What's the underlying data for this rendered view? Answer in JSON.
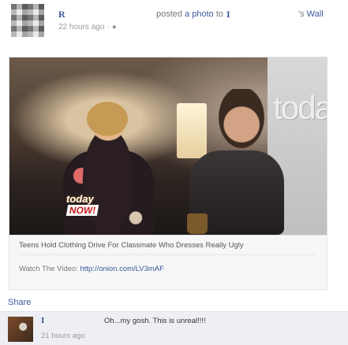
{
  "post": {
    "poster_name": "R",
    "posted_prefix": "posted",
    "posted_link": "a photo",
    "posted_to": "to",
    "wall_owner": "I",
    "wall_suffix": "'s",
    "wall_link": "Wall",
    "timestamp": "22 hours ago",
    "timestamp_sep": "·"
  },
  "photo": {
    "backdrop_text": "toda",
    "logo_today": "today",
    "logo_now": "NOW!"
  },
  "caption": {
    "title": "Teens Hold Clothing Drive For Classmate Who Dresses Really Ugly",
    "video_label": "Watch The Video:",
    "video_url": "http://onion.com/LV3mAF"
  },
  "actions": {
    "share_label": "Share"
  },
  "comment": {
    "author": "I",
    "time": "21 hours ago",
    "text": "Oh...my gosh. This is unreal!!!!"
  },
  "icons": {
    "globe": "globe-icon"
  },
  "colors": {
    "link": "#3b5998",
    "comment_bg": "#edeff4"
  }
}
